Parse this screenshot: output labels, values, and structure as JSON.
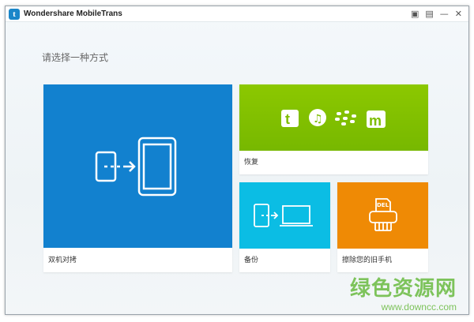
{
  "window": {
    "title": "Wondershare MobileTrans",
    "logo_letter": "t",
    "controls": [
      "feedback-icon",
      "register-icon",
      "minimize",
      "close"
    ]
  },
  "prompt": "请选择一种方式",
  "tiles": [
    {
      "label": "双机对拷",
      "color": "#1281cf"
    },
    {
      "label": "恢复",
      "color": "#80c000"
    },
    {
      "label": "备份",
      "color": "#0bbde4"
    },
    {
      "label": "擦除您的旧手机",
      "color": "#ef8a05",
      "icon_text": "DEL"
    }
  ],
  "watermark": {
    "title": "绿色资源网",
    "url": "www.downcc.com"
  }
}
